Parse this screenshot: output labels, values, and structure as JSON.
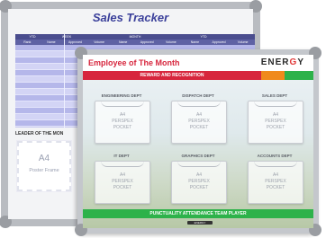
{
  "sales_tracker": {
    "title": "Sales Tracker",
    "header_row1": [
      "YTD",
      "WEEK",
      "",
      "MONTH",
      "",
      "YTD",
      ""
    ],
    "header_row2": [
      "Rank",
      "Name",
      "Approved",
      "Volume",
      "Name",
      "Approved",
      "Volume",
      "Name",
      "Approved",
      "Volume"
    ],
    "leader_label": "LEADER OF THE MON",
    "poster_a4": "A4",
    "poster_label": "Poster Frame"
  },
  "employee_board": {
    "title": "Employee of The Month",
    "brand": "ENERGY",
    "banner": "REWARD AND RECOGNITION",
    "footer": "PUNCTUALITY ATTENDANCE TEAM PLAYER",
    "pocket_lines": [
      "A4",
      "PERSPEX",
      "POCKET"
    ],
    "departments": [
      "ENGINEERING DEPT",
      "DISPATCH DEPT",
      "SALES DEPT",
      "IT DEPT",
      "GRAPHICS DEPT",
      "ACCOUNTS DEPT"
    ]
  },
  "colors": {
    "tracker_title": "#3a3f9a",
    "eotm_red": "#d7263d",
    "accent_orange": "#f08a1c",
    "accent_green": "#2db24a"
  }
}
